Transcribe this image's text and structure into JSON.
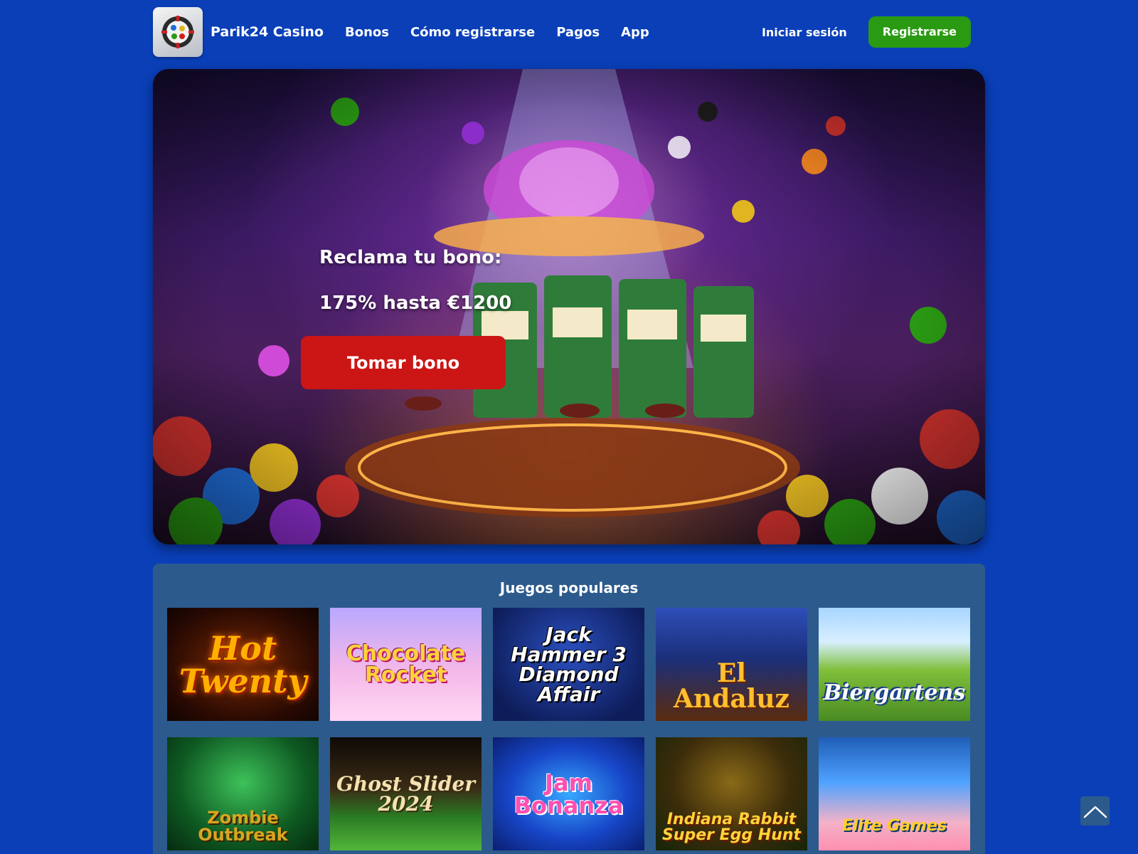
{
  "header": {
    "brand": "Parik24 Casino",
    "logo_icon": "casino-chip-logo-icon",
    "nav": [
      {
        "label": "Bonos"
      },
      {
        "label": "Cómo registrarse"
      },
      {
        "label": "Pagos"
      },
      {
        "label": "App"
      }
    ],
    "login_label": "Iniciar sesión",
    "register_label": "Registrarse",
    "accent_green": "#2a9a13"
  },
  "hero": {
    "line1": "Reclama tu bono:",
    "line2": "175% hasta €1200",
    "cta_label": "Tomar bono",
    "cta_color": "#cc1515"
  },
  "games": {
    "title": "Juegos populares",
    "items": [
      {
        "name": "Hot Twenty"
      },
      {
        "name": "Chocolate Rocket"
      },
      {
        "name": "Jack Hammer 3 Diamond Affair"
      },
      {
        "name": "El Andaluz"
      },
      {
        "name": "Biergartens"
      },
      {
        "name": "Zombie Outbreak"
      },
      {
        "name": "Ghost Slider 2024"
      },
      {
        "name": "Jam Bonanza"
      },
      {
        "name": "Indiana Rabbit Super Egg Hunt"
      },
      {
        "name": "Elite Games"
      }
    ]
  },
  "scroll_top_icon": "chevron-up-icon",
  "colors": {
    "page_bg": "#0a3fb8",
    "panel_bg": "#2c5a8c"
  }
}
